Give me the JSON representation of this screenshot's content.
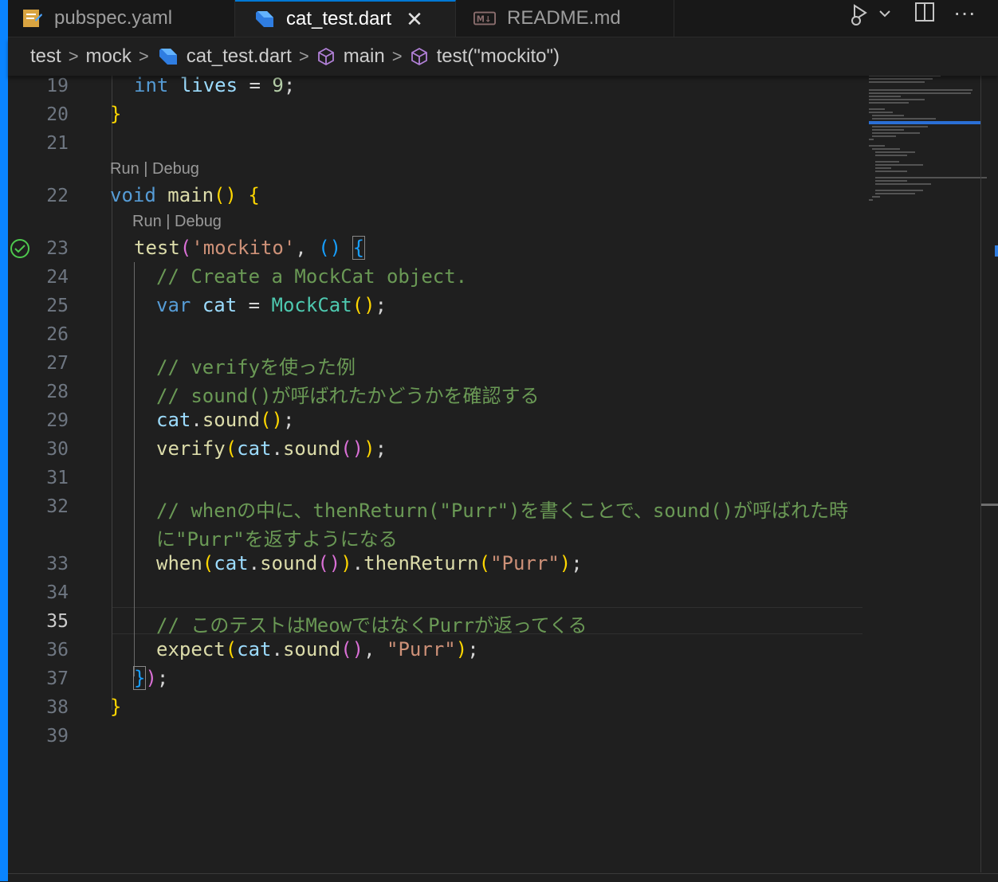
{
  "tabs": [
    {
      "label": "pubspec.yaml",
      "icon": "yaml-file-icon",
      "active": false
    },
    {
      "label": "cat_test.dart",
      "icon": "dart-file-icon",
      "active": true,
      "close": "✕"
    },
    {
      "label": "README.md",
      "icon": "markdown-file-icon",
      "active": false
    }
  ],
  "toolbar": {
    "icons": [
      "run-debug-icon",
      "chevron-down-icon",
      "split-editor-icon",
      "more-actions-icon"
    ],
    "more": "···"
  },
  "breadcrumb": {
    "items": [
      "test",
      "mock",
      "cat_test.dart",
      "main",
      "test(\"mockito\")"
    ],
    "separator": ">"
  },
  "editor": {
    "current_line": "35",
    "lenses": {
      "main": "Run | Debug",
      "test": "Run | Debug"
    },
    "line_numbers": [
      "19",
      "20",
      "21",
      "22",
      "23",
      "24",
      "25",
      "26",
      "27",
      "28",
      "29",
      "30",
      "31",
      "32",
      "33",
      "34",
      "35",
      "36",
      "37",
      "38",
      "39"
    ],
    "tokens": {
      "int": "int",
      "lives": "lives",
      "eq": " = ",
      "nine": "9",
      "semi": ";",
      "close_brace": "}",
      "void": "void",
      "main": "main",
      "parens": "()",
      "open_brace": " {",
      "test": "test",
      "lp": "(",
      "mockito_str": "'mockito'",
      "comma": ", ",
      "arrow_parens": "()",
      "space": " ",
      "brace_open": "{",
      "c24": "// Create a MockCat object.",
      "var": "var",
      "cat": "cat",
      "MockCat": "MockCat",
      "c27": "// verifyを使った例",
      "c28": "// sound()が呼ばれたかどうかを確認する",
      "dot": ".",
      "sound": "sound",
      "verify": "verify",
      "c32a": "// whenの中に、thenReturn(\"Purr\")を書くことで、sound()が呼ばれた時",
      "c32b": "に\"Purr\"を返すようになる",
      "when": "when",
      "thenReturn": "thenReturn",
      "purr_str": "\"Purr\"",
      "c35": "// このテストはMeowではなくPurrが返ってくる",
      "expect": "expect",
      "rp": ")",
      "brace_close": "}"
    }
  },
  "colors": {
    "accent": "#0a84ff",
    "test_passed": "#4ec94e"
  }
}
